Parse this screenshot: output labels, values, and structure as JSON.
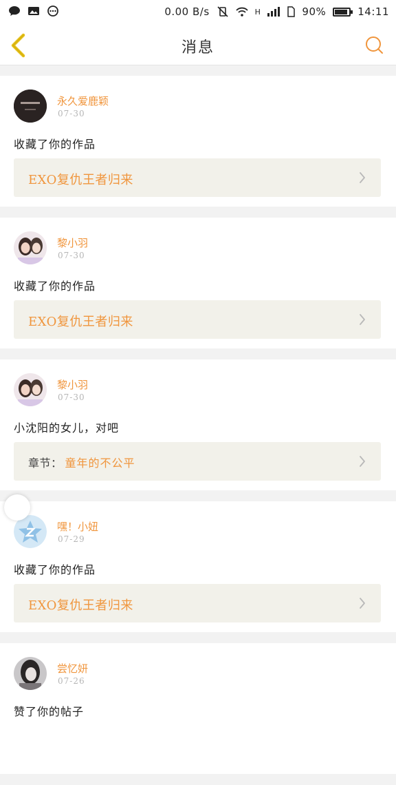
{
  "status_bar": {
    "speed": "0.00 B/s",
    "network": "H",
    "battery": "90%",
    "battery_level": 0.9,
    "time": "14:11"
  },
  "header": {
    "title": "消息",
    "back_icon": "chevron-left-icon",
    "search_icon": "search-icon"
  },
  "colors": {
    "accent": "#f0953c",
    "back_icon": "#e6c11a",
    "card_ref_bg": "#f2f1ea",
    "page_bg": "#f2f2f2"
  },
  "messages": [
    {
      "user": "永久爱鹿颖",
      "date": "07-30",
      "text": "收藏了你的作品",
      "ref_title": "EXO复仇王者归来",
      "avatar": "dark-avatar"
    },
    {
      "user": "黎小羽",
      "date": "07-30",
      "text": "收藏了你的作品",
      "ref_title": "EXO复仇王者归来",
      "avatar": "couple-avatar"
    },
    {
      "user": "黎小羽",
      "date": "07-30",
      "text": "小沈阳的女儿，对吧",
      "ref_prefix": "章节：",
      "ref_title": "童年的不公平",
      "avatar": "couple-avatar"
    },
    {
      "user": "嘿！小妞",
      "date": "07-29",
      "text": "收藏了你的作品",
      "ref_title": "EXO复仇王者归来",
      "avatar": "qzone-avatar"
    },
    {
      "user": "尝忆妍",
      "date": "07-26",
      "text": "赞了你的帖子",
      "avatar": "girl-avatar"
    }
  ]
}
